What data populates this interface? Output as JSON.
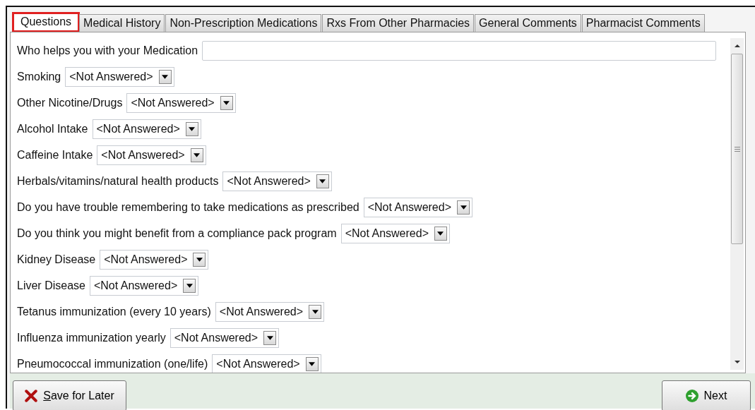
{
  "tabs": [
    {
      "label": "Questions",
      "selected": true
    },
    {
      "label": "Medical History",
      "selected": false
    },
    {
      "label": "Non-Prescription Medications",
      "selected": false
    },
    {
      "label": "Rxs From Other Pharmacies",
      "selected": false
    },
    {
      "label": "General Comments",
      "selected": false
    },
    {
      "label": "Pharmacist Comments",
      "selected": false
    }
  ],
  "questions": [
    {
      "kind": "text",
      "label": "Who helps you with your Medication"
    },
    {
      "kind": "select",
      "label": "Smoking",
      "value": "<Not Answered>"
    },
    {
      "kind": "select",
      "label": "Other Nicotine/Drugs",
      "value": "<Not Answered>"
    },
    {
      "kind": "select",
      "label": "Alcohol Intake",
      "value": "<Not Answered>"
    },
    {
      "kind": "select",
      "label": "Caffeine Intake",
      "value": "<Not Answered>"
    },
    {
      "kind": "select",
      "label": "Herbals/vitamins/natural health products",
      "value": "<Not Answered>"
    },
    {
      "kind": "select",
      "label": "Do you have trouble remembering to take medications as prescribed",
      "value": "<Not Answered>"
    },
    {
      "kind": "select",
      "label": "Do you think you might benefit from a compliance pack program",
      "value": "<Not Answered>"
    },
    {
      "kind": "select",
      "label": "Kidney Disease",
      "value": "<Not Answered>"
    },
    {
      "kind": "select",
      "label": "Liver Disease",
      "value": "<Not Answered>"
    },
    {
      "kind": "select",
      "label": "Tetanus immunization (every 10 years)",
      "value": "<Not Answered>"
    },
    {
      "kind": "select",
      "label": "Influenza immunization yearly",
      "value": "<Not Answered>"
    },
    {
      "kind": "select",
      "label": "Pneumococcal immunization (one/life)",
      "value": "<Not Answered>"
    }
  ],
  "buttons": [
    {
      "kind": "cancel",
      "label": "Save for Later"
    },
    {
      "kind": "next",
      "label": "Next"
    }
  ]
}
